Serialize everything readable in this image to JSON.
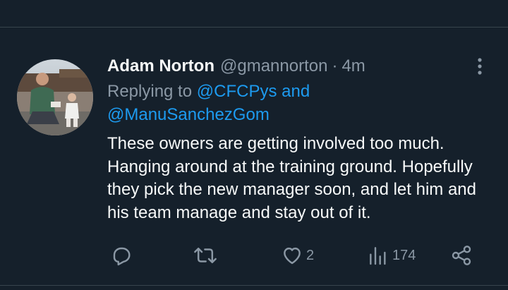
{
  "tweet": {
    "display_name": "Adam Norton",
    "handle": "@gmannorton",
    "separator": "·",
    "time": "4m",
    "replying_prefix": "Replying to",
    "mention_1": "@CFCPys",
    "and_word": "and",
    "mention_2": "@ManuSanchezGom",
    "text_lines": [
      "These owners are getting involved too much.",
      "Hanging around at the training ground. Hopefully",
      "they pick the new manager soon, and let him and",
      "his team manage and stay out of it."
    ]
  },
  "actions": {
    "reply_icon": "reply-icon",
    "retweet_icon": "retweet-icon",
    "like_icon": "heart-icon",
    "like_count": "2",
    "views_icon": "views-icon",
    "views_count": "174",
    "share_icon": "share-icon"
  },
  "colors": {
    "background": "#15202b",
    "text": "#f7f9f9",
    "muted": "#8b98a5",
    "link": "#1d9bf0",
    "divider": "#38444d"
  }
}
